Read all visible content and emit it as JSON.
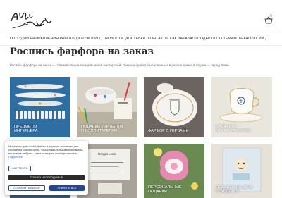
{
  "header": {
    "logo_text": "Atelier Equilibre",
    "cart_count": "0"
  },
  "nav": {
    "items": [
      {
        "label": "О СТУДИИ",
        "dropdown": false
      },
      {
        "label": "НАПРАВЛЕНИЯ РАБОТЫ",
        "dropdown": true
      },
      {
        "label": "ПОРТФОЛИО",
        "dropdown": true
      },
      {
        "label": "НОВОСТИ",
        "dropdown": false
      },
      {
        "label": "ДОСТАВКА",
        "dropdown": false
      },
      {
        "label": "КОНТАКТЫ",
        "dropdown": false
      },
      {
        "label": "КАК ЗАКАЗАТЬ",
        "dropdown": false
      },
      {
        "label": "ПОДАРКИ ПО ТЕМАМ",
        "dropdown": false
      },
      {
        "label": "ТЕХНОЛОГИИ",
        "dropdown": true
      }
    ]
  },
  "page": {
    "title": "Роспись фарфора на заказ",
    "intro": "Роспись фарфора на заказ — главная специализация нашей мастерской. Примеры работ, выполненных в разное время в студии — перед Вами."
  },
  "cards": [
    {
      "label_line1": "ПРЕДМЕТЫ",
      "label_line2": "ИНТЕРЬЕРА"
    },
    {
      "label_line1": "ПОДАРКИ УЧИТЕЛЯМ",
      "label_line2": "И ВОСПИТАТЕЛЯМ"
    },
    {
      "label_line1": "ФАРФОР С ГЕРБАМИ",
      "label_line2": ""
    },
    {
      "label_line1": "ФАРФОР С",
      "label_line2": "МОНОГРАММАМИ"
    },
    {
      "label_line1": "",
      "label_line2": ""
    },
    {
      "label_line1": "",
      "label_line2": "",
      "inner_text": "Morgan Lewis"
    },
    {
      "label_line1": "ПЕРСОНАЛЬНЫЕ",
      "label_line2": "ПОДАРКИ"
    },
    {
      "label_line1": "ПОДАРКИ НА ДЕНЬ",
      "label_line2": "РОЖДЕНИЯ"
    }
  ],
  "cookie": {
    "text": "Мы используем cookie-файлы и сервисы аналитики для улучшения работы сайта. Продолжая пользоваться сайтом, вы можете выбрать, какие категории cookie разрешить.",
    "link": "Подробнее",
    "settings_label": "НАСТРОИТЬ",
    "required_label": "ТОЛЬКО НЕОБХОДИМЫЕ",
    "save_label": "СОХРАНИТЬ ВЫБОР",
    "accept_label": "ПРИНЯТЬ ВСЕ"
  },
  "colors": {
    "accent": "#24469a",
    "dark_button": "#2b2b2b",
    "title": "#2c2c2c"
  },
  "icons": {
    "cart": "basket-icon",
    "dropdown": "chevron-down-icon"
  }
}
